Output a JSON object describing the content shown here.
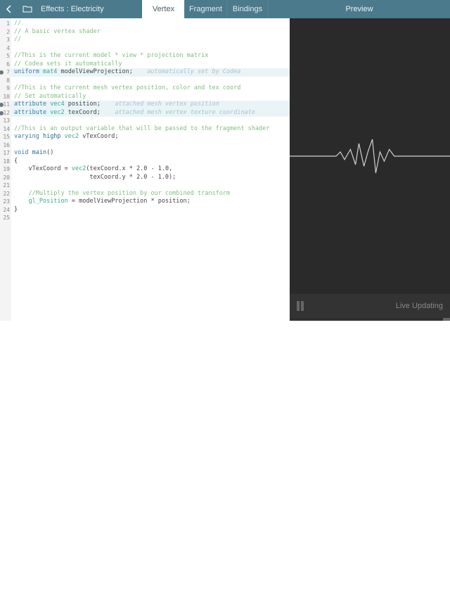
{
  "header": {
    "title": "Effects : Electricity",
    "preview_label": "Preview"
  },
  "tabs": [
    {
      "label": "Vertex",
      "active": true
    },
    {
      "label": "Fragment",
      "active": false
    },
    {
      "label": "Bindings",
      "active": false
    }
  ],
  "code_lines": [
    {
      "n": 1,
      "tokens": [
        [
          "//",
          "comment"
        ]
      ]
    },
    {
      "n": 2,
      "tokens": [
        [
          "// A basic vertex shader",
          "comment"
        ]
      ]
    },
    {
      "n": 3,
      "tokens": [
        [
          "//",
          "comment"
        ]
      ]
    },
    {
      "n": 4,
      "tokens": []
    },
    {
      "n": 5,
      "tokens": [
        [
          "//This is the current model * view * projection matrix",
          "comment"
        ]
      ]
    },
    {
      "n": 6,
      "tokens": [
        [
          "// Codea sets it automatically",
          "comment"
        ]
      ]
    },
    {
      "n": 7,
      "hl": true,
      "marked": true,
      "tokens": [
        [
          "uniform ",
          "blue"
        ],
        [
          "mat4 ",
          "teal"
        ],
        [
          "modelViewProjection",
          "black"
        ],
        [
          ";    ",
          "black"
        ],
        [
          "automatically set by Codea",
          "hint"
        ]
      ]
    },
    {
      "n": 8,
      "tokens": []
    },
    {
      "n": 9,
      "tokens": [
        [
          "//This is the current mesh vertex position, color and tex coord",
          "comment"
        ]
      ]
    },
    {
      "n": 10,
      "tokens": [
        [
          "// Set automatically",
          "comment"
        ]
      ]
    },
    {
      "n": 11,
      "hl": true,
      "marked": true,
      "tokens": [
        [
          "attribute ",
          "blue"
        ],
        [
          "vec4 ",
          "teal"
        ],
        [
          "position",
          "black"
        ],
        [
          ";    ",
          "black"
        ],
        [
          "attached mesh vertex position",
          "hint"
        ]
      ]
    },
    {
      "n": 12,
      "hl": true,
      "marked": true,
      "tokens": [
        [
          "attribute ",
          "blue"
        ],
        [
          "vec2 ",
          "teal"
        ],
        [
          "texCoord",
          "black"
        ],
        [
          ";    ",
          "black"
        ],
        [
          "attached mesh vertex texture coordinate",
          "hint"
        ]
      ]
    },
    {
      "n": 13,
      "tokens": []
    },
    {
      "n": 14,
      "tokens": [
        [
          "//This is an output variable that will be passed to the fragment shader",
          "comment"
        ]
      ]
    },
    {
      "n": 15,
      "tokens": [
        [
          "varying ",
          "blue"
        ],
        [
          "highp ",
          "dark"
        ],
        [
          "vec2 ",
          "teal"
        ],
        [
          "vTexCoord",
          "black"
        ],
        [
          ";",
          "black"
        ]
      ]
    },
    {
      "n": 16,
      "tokens": []
    },
    {
      "n": 17,
      "tokens": [
        [
          "void ",
          "blue"
        ],
        [
          "main",
          "dark"
        ],
        [
          "()",
          "black"
        ]
      ]
    },
    {
      "n": 18,
      "tokens": [
        [
          "{",
          "black"
        ]
      ]
    },
    {
      "n": 19,
      "tokens": [
        [
          "    vTexCoord = ",
          "black"
        ],
        [
          "vec2",
          "teal"
        ],
        [
          "(texCoord.x * 2.0 - 1.0,",
          "black"
        ]
      ]
    },
    {
      "n": 20,
      "tokens": [
        [
          "                     texCoord.y * 2.0 - 1.0);",
          "black"
        ]
      ]
    },
    {
      "n": 21,
      "tokens": []
    },
    {
      "n": 22,
      "tokens": [
        [
          "    //Multiply the vertex position by our combined transform",
          "comment"
        ]
      ]
    },
    {
      "n": 23,
      "tokens": [
        [
          "    ",
          "black"
        ],
        [
          "gl_Position",
          "teal"
        ],
        [
          " = modelViewProjection * position;",
          "black"
        ]
      ]
    },
    {
      "n": 24,
      "tokens": [
        [
          "}",
          "black"
        ]
      ]
    },
    {
      "n": 25,
      "tokens": []
    }
  ],
  "preview_footer": {
    "live_label": "Live Updating"
  }
}
